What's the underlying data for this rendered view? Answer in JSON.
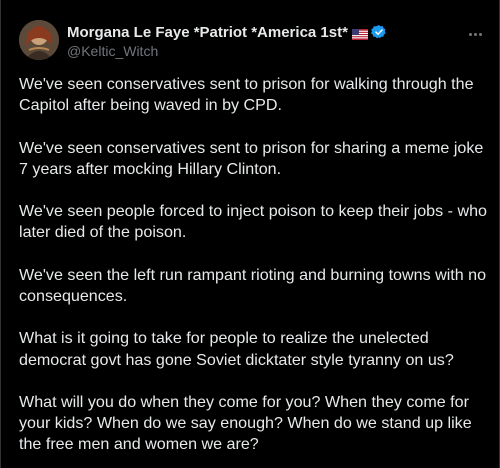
{
  "author": {
    "display_name": "Morgana Le Faye *Patriot *America 1st*",
    "handle": "@Keltic_Witch",
    "flag_icon": "us-flag-icon",
    "verified_icon": "verified-badge-icon",
    "verified_color": "#1d9bf0"
  },
  "tweet": {
    "paragraphs": [
      "We've seen conservatives sent to prison for walking through the Capitol after being waved in by CPD.",
      "We've seen conservatives sent to prison for sharing a meme joke 7 years after mocking Hillary Clinton.",
      "We've seen people forced to inject poison to keep their jobs - who later died of the poison.",
      "We've seen the left run rampant rioting and burning towns with no consequences.",
      "What is it going to take for people to realize the unelected democrat govt has gone Soviet dicktater  style tyranny on us?",
      "What will you do when they come for you?  When they come for your kids?  When do we say enough?  When do we stand up like the free men and women we are?"
    ]
  },
  "theme": {
    "background": "#000000",
    "text": "#e7e9ea",
    "muted": "#71767b"
  }
}
